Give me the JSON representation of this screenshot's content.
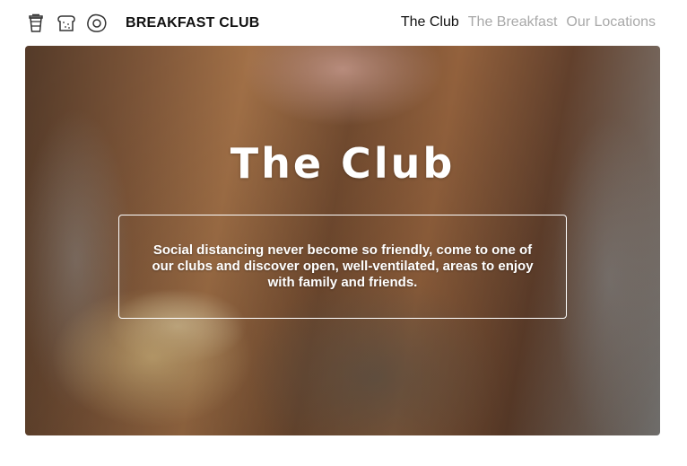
{
  "brand": {
    "name": "BREAKFAST CLUB",
    "icons": [
      "coffee-cup-icon",
      "toast-icon",
      "egg-icon"
    ]
  },
  "nav": {
    "items": [
      {
        "label": "The Club",
        "active": true
      },
      {
        "label": "The Breakfast",
        "active": false
      },
      {
        "label": "Our Locations",
        "active": false
      }
    ]
  },
  "hero": {
    "title": "The Club",
    "text": "Social distancing never become so friendly, come to one of our clubs and discover open, well-ventilated, areas to enjoy with family and friends."
  },
  "colors": {
    "text_primary": "#111111",
    "nav_inactive": "#a8a8a8",
    "hero_text": "#ffffff"
  }
}
